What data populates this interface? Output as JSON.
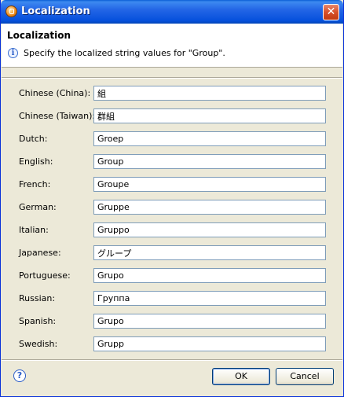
{
  "window": {
    "title": "Localization",
    "close_glyph": "✕"
  },
  "banner": {
    "title": "Localization",
    "message": "Specify the localized string values for \"Group\"."
  },
  "rows": [
    {
      "label": "Chinese (China):",
      "value": "組"
    },
    {
      "label": "Chinese (Taiwan):",
      "value": "群組"
    },
    {
      "label": "Dutch:",
      "value": "Groep"
    },
    {
      "label": "English:",
      "value": "Group"
    },
    {
      "label": "French:",
      "value": "Groupe"
    },
    {
      "label": "German:",
      "value": "Gruppe"
    },
    {
      "label": "Italian:",
      "value": "Gruppo"
    },
    {
      "label": "Japanese:",
      "value": "グループ"
    },
    {
      "label": "Portuguese:",
      "value": "Grupo"
    },
    {
      "label": "Russian:",
      "value": "Группа"
    },
    {
      "label": "Spanish:",
      "value": "Grupo"
    },
    {
      "label": "Swedish:",
      "value": "Grupp"
    }
  ],
  "footer": {
    "help_glyph": "?",
    "ok_label": "OK",
    "cancel_label": "Cancel"
  }
}
